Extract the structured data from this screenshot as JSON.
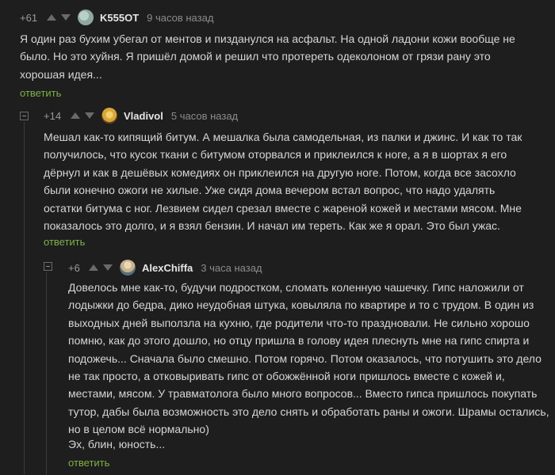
{
  "comments": [
    {
      "rating": "+61",
      "username": "K555OT",
      "time": "9 часов назад",
      "avatar_color": "#8fa8a0",
      "text": "Я один раз бухим убегал от ментов и пизданулся на асфальт. На одной ладони кожи вообще не было. Но это хуйня. Я пришёл домой и решил что протереть одеколоном от грязи рану это хорошая идея...",
      "reply": "ответить"
    },
    {
      "rating": "+14",
      "username": "Vladivol",
      "time": "5 часов назад",
      "avatar_color": "#d9a63a",
      "text": "Мешал как-то кипящий битум. А мешалка была самодельная, из палки и джинс. И как то так получилось, что кусок ткани с битумом оторвался и приклеился к ноге, а я в шортах я его дёрнул и как в дешёвых комедиях он приклеился на другую ноге. Потом, когда все засохло были конечно ожоги не хилые. Уже сидя дома вечером встал вопрос, что надо удалять остатки битума с ног. Лезвием сидел срезал вместе с жареной кожей и местами мясом. Мне показалось это долго, и я взял бензин. И начал им тереть. Как же я орал. Это был ужас.",
      "reply": "ответить"
    },
    {
      "rating": "+6",
      "username": "AlexChiffa",
      "time": "3 часа назад",
      "avatar_color": "#c9b28a",
      "text": "Довелось мне как-то, будучи подростком, сломать коленную чашечку. Гипс наложили от лодыжки до бедра, дико неудобная штука, ковыляла по квартире и то с трудом. В один из выходных дней выползла на кухню, где родители что-то праздновали. Не сильно хорошо помню, как до этого дошло, но отцу пришла в голову идея плеснуть мне на гипс спирта и подожечь... Сначала было смешно. Потом горячо. Потом оказалось, что потушить это дело не так просто, а отковыривать гипс от обожжённой ноги пришлось вместе с кожей и, местами, мясом. У травматолога было много вопросов... Вместо гипса пришлось покупать тутор, дабы была возможность это дело снять и обработать раны и ожоги. Шрамы остались, но в целом всё нормально)",
      "text2": "Эх, блин, юность...",
      "reply": "ответить"
    }
  ]
}
